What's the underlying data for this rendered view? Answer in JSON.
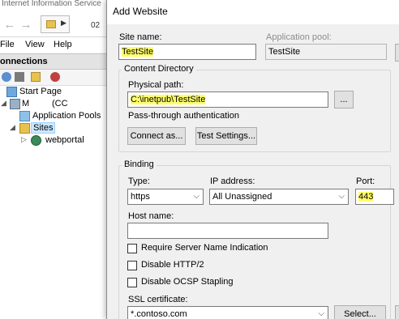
{
  "iis": {
    "window_title": "Internet Information Service",
    "address_text": "02",
    "menu": [
      "File",
      "View",
      "Help"
    ],
    "connections_header": "onnections",
    "tree": {
      "start_page": "Start Page",
      "server_prefix": "M",
      "server_suffix": "(CC",
      "app_pools": "Application Pools",
      "sites": "Sites",
      "webportal": "webportal"
    }
  },
  "dialog": {
    "title": "Add Website",
    "site_name_label": "Site name:",
    "site_name_value": "TestSite",
    "app_pool_label": "Application pool:",
    "app_pool_value": "TestSite",
    "content_directory_label": "Content Directory",
    "physical_path_label": "Physical path:",
    "physical_path_prefix": "C:\\inetpub\\",
    "physical_path_highlight": "TestSite",
    "browse_label": "...",
    "pass_through_label": "Pass-through authentication",
    "connect_as_label": "Connect as...",
    "test_settings_label": "Test Settings...",
    "binding_label": "Binding",
    "type_label": "Type:",
    "type_value": "https",
    "ip_label": "IP address:",
    "ip_value": "All Unassigned",
    "port_label": "Port:",
    "port_value": "443",
    "host_name_label": "Host name:",
    "host_name_value": "",
    "checkboxes": [
      {
        "label": "Require Server Name Indication",
        "checked": false
      },
      {
        "label": "Disable HTTP/2",
        "checked": false
      },
      {
        "label": "Disable OCSP Stapling",
        "checked": false
      }
    ],
    "ssl_label": "SSL certificate:",
    "ssl_value": "*.contoso.com",
    "select_label": "Select..."
  },
  "colors": {
    "highlight": "#ffff6b",
    "dialog_bg": "#f0f0f0",
    "selection": "#cce8ff"
  }
}
